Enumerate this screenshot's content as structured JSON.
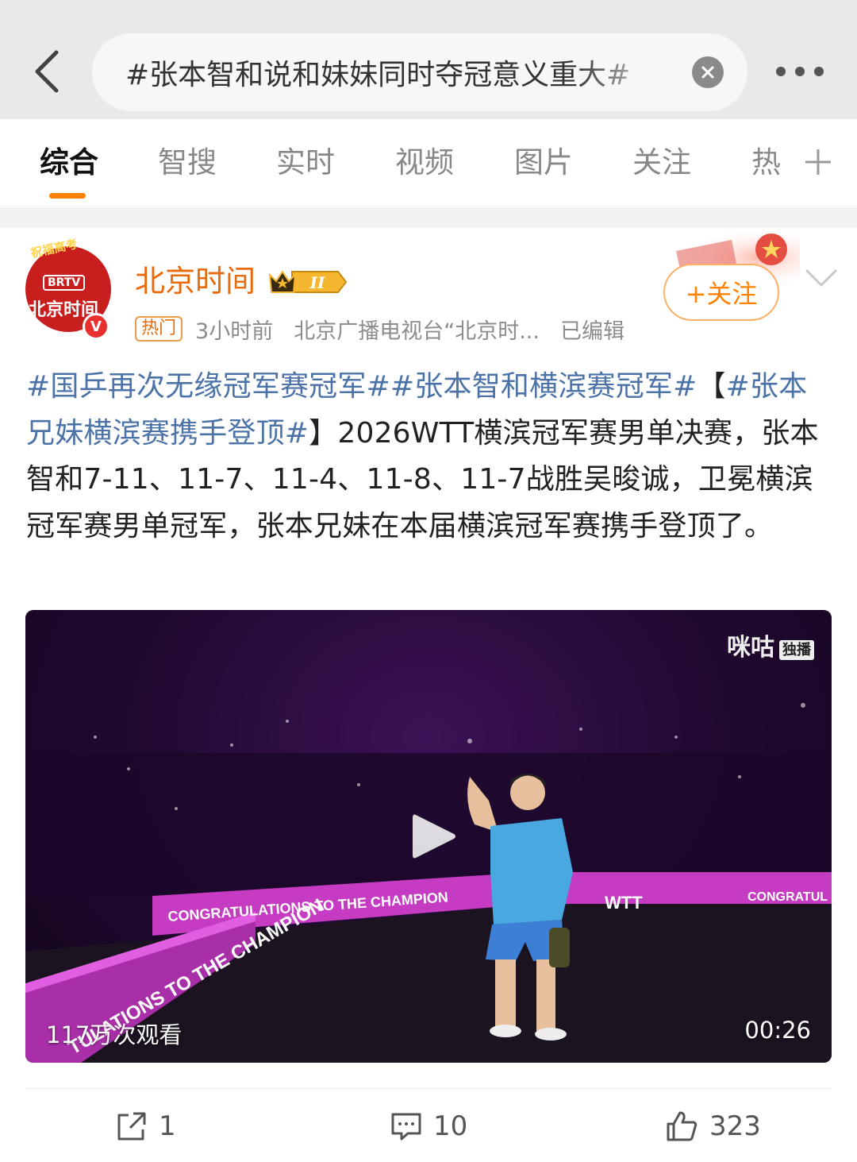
{
  "search": {
    "query": "#张本智和说和妹妹同时夺冠意义重大#"
  },
  "tabs": [
    {
      "label": "综合"
    },
    {
      "label": "智搜"
    },
    {
      "label": "实时"
    },
    {
      "label": "视频"
    },
    {
      "label": "图片"
    },
    {
      "label": "关注"
    },
    {
      "label": "热"
    }
  ],
  "colors": {
    "accent": "#ff8200",
    "author_name": "#e86b0c",
    "topic_link": "#4b73a8",
    "verified": "#e8312f"
  },
  "post": {
    "avatar": {
      "ribbon_text": "祝福高考",
      "brand": "BRTV",
      "name": "北京时间"
    },
    "author": "北京时间",
    "vip_level": "II",
    "hot_tag": "热门",
    "time": "3小时前",
    "source": "北京广播电视台“北京时...",
    "edited": "已编辑",
    "follow_label": "+关注",
    "text": {
      "topic1": "#国乒再次无缘冠军赛冠军#",
      "topic2": "#张本智和横滨赛冠军#",
      "bracket_open": "【",
      "topic3": "#张本兄妹横滨赛携手登顶#",
      "body": "】2026WTT横滨冠军赛男单决赛，张本智和7-11、11-7、11-4、11-8、11-7战胜吴晙诚，卫冕横滨冠军赛男单冠军，张本兄妹在本届横滨冠军赛携手登顶了。"
    },
    "video": {
      "watermark": "咪咕",
      "watermark_tag": "独播",
      "banner_text_1": "CONGRATULATIONS TO THE CHAMPION",
      "banner_text_2": "WTT",
      "banner_text_3": "CONGRATUL",
      "banner_text_4": "TULATIONS TO THE CHAMPION",
      "views": "117万次观看",
      "duration": "00:26"
    },
    "actions": {
      "share_count": "1",
      "comment_count": "10",
      "like_count": "323"
    }
  }
}
